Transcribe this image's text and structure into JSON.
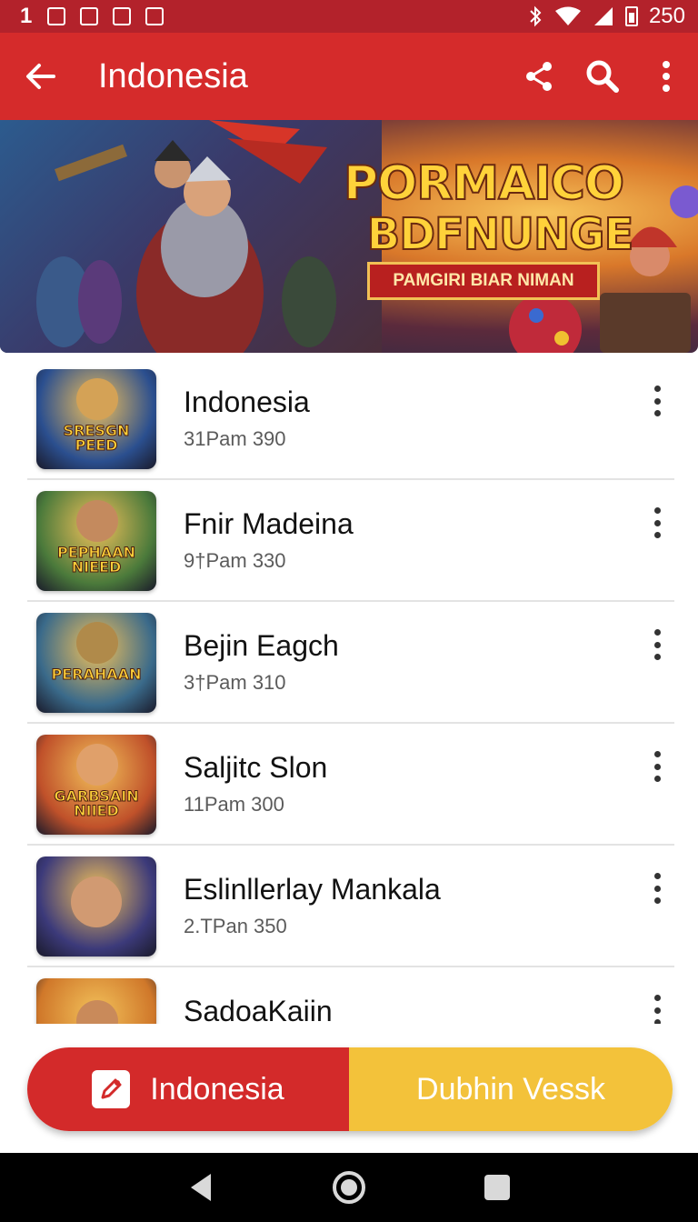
{
  "status_bar": {
    "time": "1",
    "battery_text": "250"
  },
  "app_bar": {
    "title": "Indonesia",
    "icons": [
      "back-arrow-icon",
      "share-icon",
      "search-icon",
      "more-vert-icon"
    ]
  },
  "banner": {
    "logo_line1": "PORMAICO",
    "logo_line2": "BDFNUNGE",
    "ribbon": "PAMGIRI BIAR NIMAN"
  },
  "list": {
    "items": [
      {
        "title": "Indonesia",
        "meta": "31Pam 390",
        "thumb_label": "SRESGN PEED",
        "thumb_bg": "#2b4f8f"
      },
      {
        "title": "Fnir Madeina",
        "meta": "9†Pam 330",
        "thumb_label": "PEPHAAN NIEED",
        "thumb_bg": "#4b7a3b"
      },
      {
        "title": "Bejin Eagch",
        "meta": "3†Pam 310",
        "thumb_label": "PERAHAAN",
        "thumb_bg": "#3a6a8a"
      },
      {
        "title": "Saljitc Slon",
        "meta": "11Pam 300",
        "thumb_label": "GARBSAIN NIIED",
        "thumb_bg": "#c0512a"
      },
      {
        "title": "Eslinllerlay Mankala",
        "meta": "2.TPan 350",
        "thumb_label": "",
        "thumb_bg": "#3c3a7a"
      },
      {
        "title": "SadoaKaiin",
        "meta": "",
        "thumb_label": "",
        "thumb_bg": "#d0782a"
      }
    ]
  },
  "cta": {
    "left_label": "Indonesia",
    "right_label": "Dubhin Vessk",
    "left_color": "#d32a2a",
    "right_color": "#f3c23a"
  },
  "nav_bar": {
    "icons": [
      "nav-back-icon",
      "nav-home-icon",
      "nav-recents-icon"
    ]
  }
}
